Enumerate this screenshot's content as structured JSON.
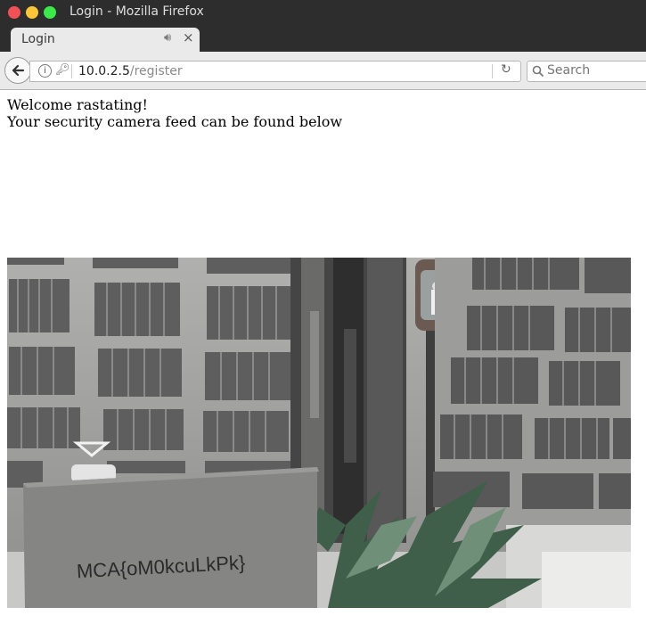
{
  "window": {
    "title": "Login - Mozilla Firefox"
  },
  "tab": {
    "label": "Login",
    "new_tab_symbol": "+"
  },
  "navbar": {
    "url_host": "10.0.2.5",
    "url_path": "/register",
    "search_placeholder": "Search"
  },
  "page": {
    "welcome": "Welcome rastating!",
    "message": "Your security camera feed can be found below"
  },
  "camera": {
    "sign_text": "MCA{oM0kcuLkPk}"
  },
  "icons": [
    "close-window-icon",
    "minimize-window-icon",
    "maximize-window-icon",
    "speaker-icon",
    "close-icon",
    "plus-icon",
    "back-arrow-icon",
    "info-icon",
    "key-icon",
    "reload-icon",
    "search-icon"
  ],
  "colors": {
    "titlebar": "#2d2d2d",
    "tab": "#eaeaea",
    "close": "#f25056",
    "minimize": "#fac536",
    "maximize": "#39ea49"
  }
}
